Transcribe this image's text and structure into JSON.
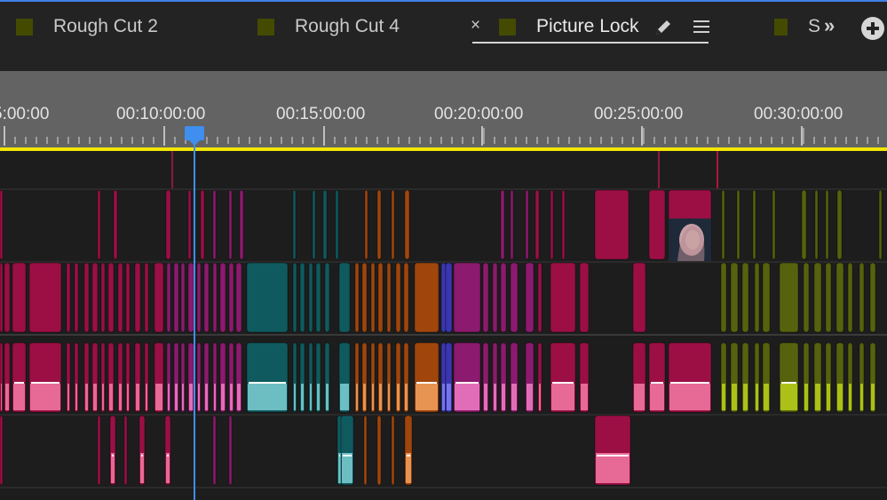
{
  "tabs": [
    {
      "label": "Rough Cut 2",
      "active": false
    },
    {
      "label": "Rough Cut 4",
      "active": false
    },
    {
      "label": "Picture Lock",
      "active": true
    },
    {
      "label": "S",
      "active": false
    }
  ],
  "tab_controls": {
    "close_icon": "close-icon",
    "close_glyph": "×",
    "edit_icon": "pencil-icon",
    "menu_icon": "hamburger-menu-icon",
    "overflow_icon": "chevron-double-right-icon",
    "overflow_glyph": "»",
    "add_icon": "add-circle-icon"
  },
  "ruler": {
    "timecodes": [
      "5:00:00",
      "00:10:00:00",
      "00:15:00:00",
      "00:20:00:00",
      "00:25:00:00",
      "00:30:00:00"
    ]
  },
  "playhead": {
    "timecode_position": "approx 00:10:30:00"
  },
  "colors": {
    "accent": "#3f80e8",
    "playhead": "#3f8ef0",
    "work_area": "#f2e500",
    "crimson": "#9b0f45",
    "magenta": "#8c1a6e",
    "teal": "#0f5a5e",
    "orange": "#a0450c",
    "olive": "#56620d",
    "tab_swatch": "#444a00"
  },
  "tracks": [
    "video-3",
    "video-2",
    "video-1",
    "audio-1",
    "audio-2"
  ]
}
